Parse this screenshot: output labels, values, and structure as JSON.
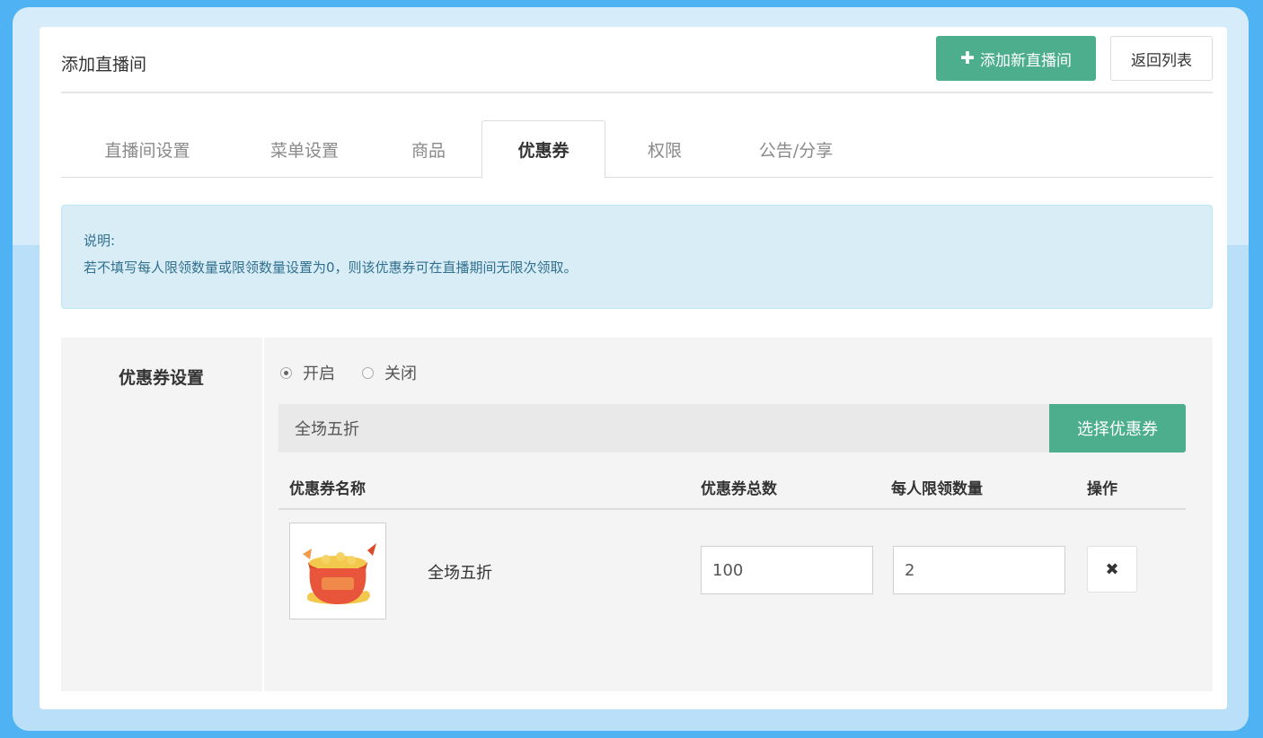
{
  "header": {
    "title": "添加直播间",
    "add_button": "添加新直播间",
    "back_button": "返回列表"
  },
  "tabs": [
    {
      "label": "直播间设置",
      "active": false
    },
    {
      "label": "菜单设置",
      "active": false
    },
    {
      "label": "商品",
      "active": false
    },
    {
      "label": "优惠券",
      "active": true
    },
    {
      "label": "权限",
      "active": false
    },
    {
      "label": "公告/分享",
      "active": false
    }
  ],
  "note": {
    "title": "说明:",
    "text": "若不填写每人限领数量或限领数量设置为0，则该优惠券可在直播期间无限次领取。"
  },
  "coupon_settings": {
    "label": "优惠券设置",
    "radio_on": "开启",
    "radio_off": "关闭",
    "selected": "on",
    "selected_coupon": "全场五折",
    "select_button": "选择优惠券",
    "table": {
      "headers": [
        "优惠券名称",
        "优惠券总数",
        "每人限领数量",
        "操作"
      ],
      "rows": [
        {
          "name": "全场五折",
          "total": "100",
          "limit": "2",
          "remove": "✖"
        }
      ]
    }
  },
  "colors": {
    "accent_green": "#4cae8c",
    "frame_blue": "#4fb3f3",
    "note_bg": "#d9edf7"
  }
}
